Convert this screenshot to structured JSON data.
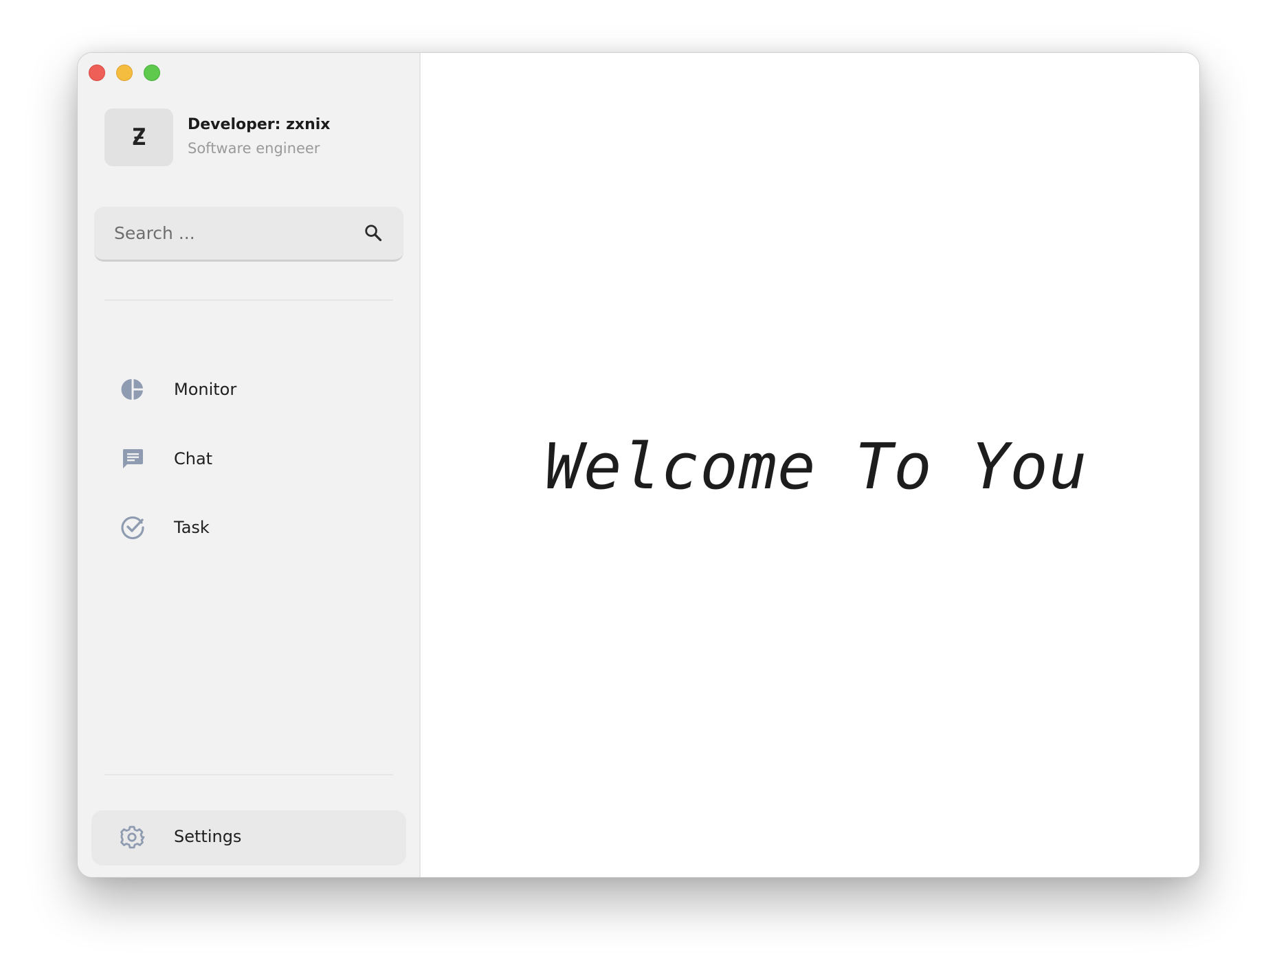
{
  "window": {
    "controls": [
      "close",
      "minimize",
      "maximize"
    ]
  },
  "profile": {
    "avatar_letter": "Ƶ",
    "name": "Developer: zxnix",
    "role": "Software engineer"
  },
  "search": {
    "placeholder": "Search ...",
    "value": "",
    "icon": "search-icon"
  },
  "nav": {
    "items": [
      {
        "label": "Monitor",
        "icon": "pie-chart-icon"
      },
      {
        "label": "Chat",
        "icon": "chat-icon"
      },
      {
        "label": "Task",
        "icon": "check-circle-icon"
      }
    ]
  },
  "settings": {
    "label": "Settings",
    "icon": "gear-icon"
  },
  "main": {
    "welcome": "Welcome To You"
  },
  "colors": {
    "sidebar_bg": "#f2f2f2",
    "icon": "#8e9bb0",
    "text": "#1f1f1f",
    "muted": "#9a9a9a"
  }
}
